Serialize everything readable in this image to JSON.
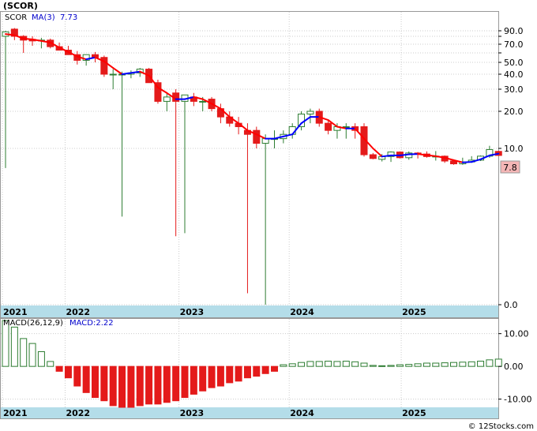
{
  "header": {
    "title": "(SCOR)",
    "symbol": "SCOR",
    "ma_label": "MA(3)",
    "ma_value": "7.73"
  },
  "macd_header": {
    "label": "MACD(26,12,9)",
    "value_label": "MACD:2.22"
  },
  "watermark": "© 12Stocks.com",
  "colors": {
    "up": "#2e7d32",
    "down": "#e41a1a",
    "ma_down": "#ff0000",
    "ma_up": "#0000ff",
    "axis_band": "#b4dde9",
    "grid": "#cccccc",
    "last_box": "#f4b6b6"
  },
  "chart_data": [
    {
      "type": "candlestick",
      "title": "(SCOR)",
      "scale": "log",
      "grid": true,
      "y_ticks": [
        90,
        80,
        70,
        60,
        50,
        40,
        30,
        20,
        10,
        0
      ],
      "y_tick_labels": [
        "90.0",
        "",
        "70.0",
        "",
        "50.0",
        "40.0",
        "30.0",
        "20.0",
        "10.0",
        "0.0"
      ],
      "x_year_labels": [
        "2021",
        "2022",
        "2023",
        "2024",
        "2025"
      ],
      "last_price_label": "7.8",
      "series": [
        {
          "name": "SCOR",
          "ohlc": [
            [
              80,
              90,
              5,
              88
            ],
            [
              93,
              95,
              75,
              80
            ],
            [
              80,
              82,
              60,
              75
            ],
            [
              76,
              80,
              68,
              74
            ],
            [
              75,
              78,
              65,
              75
            ],
            [
              75,
              77,
              65,
              67
            ],
            [
              67,
              72,
              63,
              63
            ],
            [
              63,
              68,
              58,
              58
            ],
            [
              58,
              62,
              48,
              52
            ],
            [
              52,
              58,
              47,
              58
            ],
            [
              58,
              61,
              50,
              55
            ],
            [
              55,
              57,
              38,
              40
            ],
            [
              40,
              44,
              30,
              40
            ],
            [
              40,
              42,
              0.9,
              40
            ],
            [
              40,
              43,
              37,
              41
            ],
            [
              41,
              45,
              38,
              44
            ],
            [
              44,
              45,
              34,
              34
            ],
            [
              34,
              36,
              23,
              24
            ],
            [
              24,
              28,
              20,
              26
            ],
            [
              28,
              30,
              0.45,
              24
            ],
            [
              24,
              27,
              0.5,
              27
            ],
            [
              26,
              28,
              22,
              24
            ],
            [
              24,
              26,
              20,
              24
            ],
            [
              25,
              26,
              20,
              21
            ],
            [
              21,
              23,
              16,
              18
            ],
            [
              18,
              20,
              15,
              16
            ],
            [
              16,
              18,
              13,
              15
            ],
            [
              14,
              16,
              0.06,
              13
            ],
            [
              14,
              15,
              10,
              11
            ],
            [
              11,
              13,
              0.04,
              12
            ],
            [
              12,
              14,
              10,
              12
            ],
            [
              12,
              14,
              11,
              13
            ],
            [
              13,
              16,
              12,
              15
            ],
            [
              15,
              20,
              14,
              19
            ],
            [
              19,
              21,
              16,
              20
            ],
            [
              20,
              21,
              15,
              16
            ],
            [
              16,
              17,
              13,
              14
            ],
            [
              14,
              16,
              12,
              15
            ],
            [
              15,
              16,
              12,
              15
            ],
            [
              15,
              16,
              12,
              14
            ],
            [
              15,
              16,
              7.5,
              8
            ],
            [
              8,
              8.5,
              6.8,
              7
            ],
            [
              6.8,
              8.2,
              6.3,
              7.5
            ],
            [
              7.5,
              9,
              6.2,
              8.8
            ],
            [
              8.8,
              9,
              7,
              7.2
            ],
            [
              7.2,
              9,
              6.7,
              8.5
            ],
            [
              8.5,
              8.8,
              7,
              8.2
            ],
            [
              8.2,
              9,
              7.2,
              7.5
            ],
            [
              7.5,
              9.1,
              6.5,
              7.6
            ],
            [
              7.6,
              7.8,
              6,
              6.4
            ],
            [
              6.4,
              6.6,
              5.6,
              5.8
            ],
            [
              5.8,
              7.2,
              5.6,
              6.2
            ],
            [
              6.2,
              7.6,
              6,
              6.6
            ],
            [
              6.6,
              7.8,
              6.4,
              7.6
            ],
            [
              7.6,
              10.5,
              7.2,
              9.6
            ],
            [
              9,
              9.2,
              7.7,
              7.8
            ]
          ]
        },
        {
          "name": "MA(3)",
          "values": [
            84,
            82,
            77,
            76,
            74,
            72,
            66,
            61,
            56,
            53,
            55,
            51,
            45,
            40,
            41,
            42,
            39,
            31,
            28,
            25,
            25,
            26,
            25,
            23,
            21,
            18,
            16,
            14,
            13,
            12,
            12,
            12.5,
            13,
            16,
            18,
            18,
            17,
            15,
            14.5,
            14.5,
            12,
            10,
            7.5,
            7.8,
            7.8,
            8.1,
            8.2,
            7.9,
            7.6,
            7.2,
            6.6,
            6.1,
            6.2,
            6.8,
            7.8,
            8.3
          ]
        }
      ]
    },
    {
      "type": "bar",
      "title": "MACD(26,12,9)",
      "y_ticks": [
        10,
        0,
        -10
      ],
      "y_tick_labels": [
        "10.00",
        "0.00",
        "-10.00"
      ],
      "ylim": [
        -12.5,
        14.5
      ],
      "x_year_labels": [
        "2021",
        "2022",
        "2023",
        "2024",
        "2025"
      ],
      "series": [
        {
          "name": "MACD",
          "values": [
            14,
            12,
            8.5,
            7,
            4.5,
            1.5,
            -1.5,
            -3.5,
            -6,
            -8,
            -9.5,
            -10.5,
            -12,
            -12.5,
            -12.5,
            -12,
            -11.5,
            -11.5,
            -11,
            -10.5,
            -9.5,
            -8.5,
            -7.5,
            -6.5,
            -6,
            -5,
            -4.5,
            -3.5,
            -3,
            -2.2,
            -1.5,
            0.5,
            0.8,
            1.2,
            1.5,
            1.5,
            1.6,
            1.5,
            1.6,
            1.4,
            1.0,
            0.3,
            0.2,
            0.3,
            0.5,
            0.6,
            0.8,
            1.0,
            1.0,
            1.1,
            1.2,
            1.3,
            1.4,
            1.6,
            2.0,
            2.22
          ]
        }
      ]
    }
  ]
}
